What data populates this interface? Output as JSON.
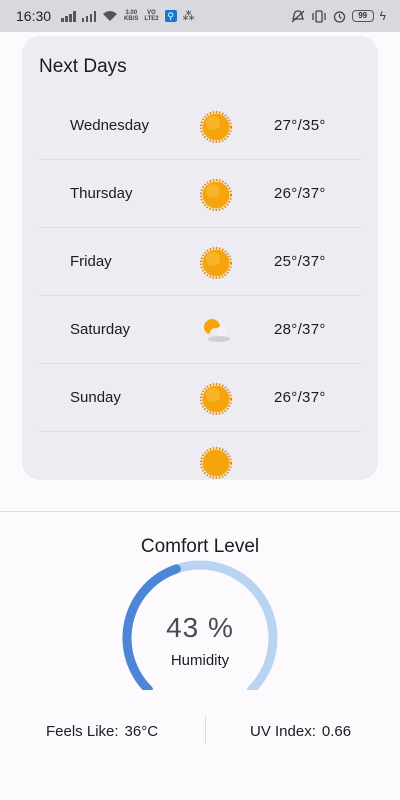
{
  "status_bar": {
    "time": "16:30",
    "net_speed_top": "3.00",
    "net_speed_bottom": "KB/S",
    "volte_top": "VO",
    "volte_bottom": "LTE2",
    "battery": "99"
  },
  "next_days": {
    "title": "Next Days",
    "days": [
      {
        "name": "Wednesday",
        "icon": "sun-icon",
        "temp": "27°/35°"
      },
      {
        "name": "Thursday",
        "icon": "sun-icon",
        "temp": "26°/37°"
      },
      {
        "name": "Friday",
        "icon": "sun-icon",
        "temp": "25°/37°"
      },
      {
        "name": "Saturday",
        "icon": "partly-cloudy-icon",
        "temp": "28°/37°"
      },
      {
        "name": "Sunday",
        "icon": "sun-icon",
        "temp": "26°/37°"
      }
    ]
  },
  "comfort": {
    "title": "Comfort Level",
    "humidity_value": "43 %",
    "humidity_percent": 43,
    "humidity_label": "Humidity",
    "feels_like_label": "Feels Like:",
    "feels_like_value": "36°C",
    "uv_label": "UV Index:",
    "uv_value": "0.66"
  },
  "colors": {
    "gauge_fill": "#4d86d6",
    "gauge_track": "#b9d3f3",
    "sun": "#f5a40c"
  }
}
